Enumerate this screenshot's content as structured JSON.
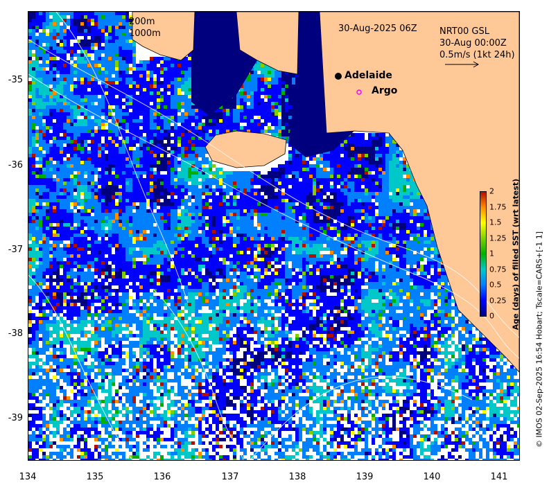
{
  "map": {
    "timestamp": "30-Aug-2025 06Z",
    "isobath_shallow": "200m",
    "isobath_deep": "1000m",
    "current_source": "NRT00 GSL",
    "current_time": "30-Aug 00:00Z",
    "current_scale": "0.5m/s (1kt 24h)",
    "place_label": "Adelaide",
    "argo_label": "Argo",
    "lat_ticks": [
      "-35",
      "-36",
      "-37",
      "-38",
      "-39"
    ],
    "lon_ticks": [
      "134",
      "135",
      "136",
      "137",
      "138",
      "139",
      "140",
      "141"
    ],
    "credit": "© IMOS 02-Sep-2025 16:54 Hobart; Tscale=CARS+[-1 1]"
  },
  "colorbar": {
    "label": "Age (days) of filled SST (wrt latest)",
    "ticks": [
      "0",
      "0.25",
      "0.5",
      "0.75",
      "1",
      "1.25",
      "1.5",
      "1.75",
      "2"
    ],
    "colors": [
      "#00007f",
      "#0000ff",
      "#007fff",
      "#00c8c8",
      "#00b000",
      "#7fd000",
      "#ffff00",
      "#ff8c00",
      "#b01000"
    ],
    "land_color": "#ffc896",
    "argo_color": "#ff00ff"
  }
}
